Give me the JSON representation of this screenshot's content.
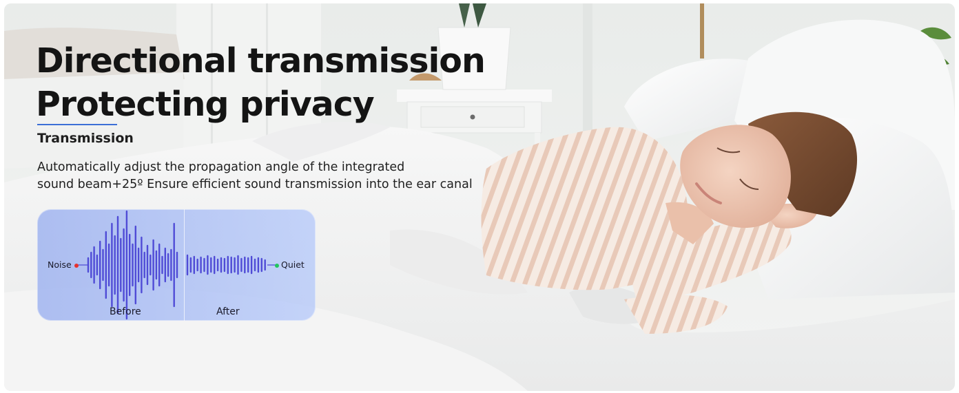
{
  "headline": {
    "line1": "Directional transmission",
    "line2": "Protecting privacy"
  },
  "subheading": "Transmission",
  "description": {
    "line1": "Automatically adjust the propagation angle of the integrated",
    "line2": "sound beam+25º Ensure efficient sound transmission into the ear canal"
  },
  "waveform": {
    "left_label": "Noise",
    "right_label": "Quiet",
    "before_label": "Before",
    "after_label": "After",
    "colors": {
      "wave": "#4f4bd6",
      "noise_dot": "#e6322e",
      "quiet_dot": "#22c55e"
    }
  }
}
